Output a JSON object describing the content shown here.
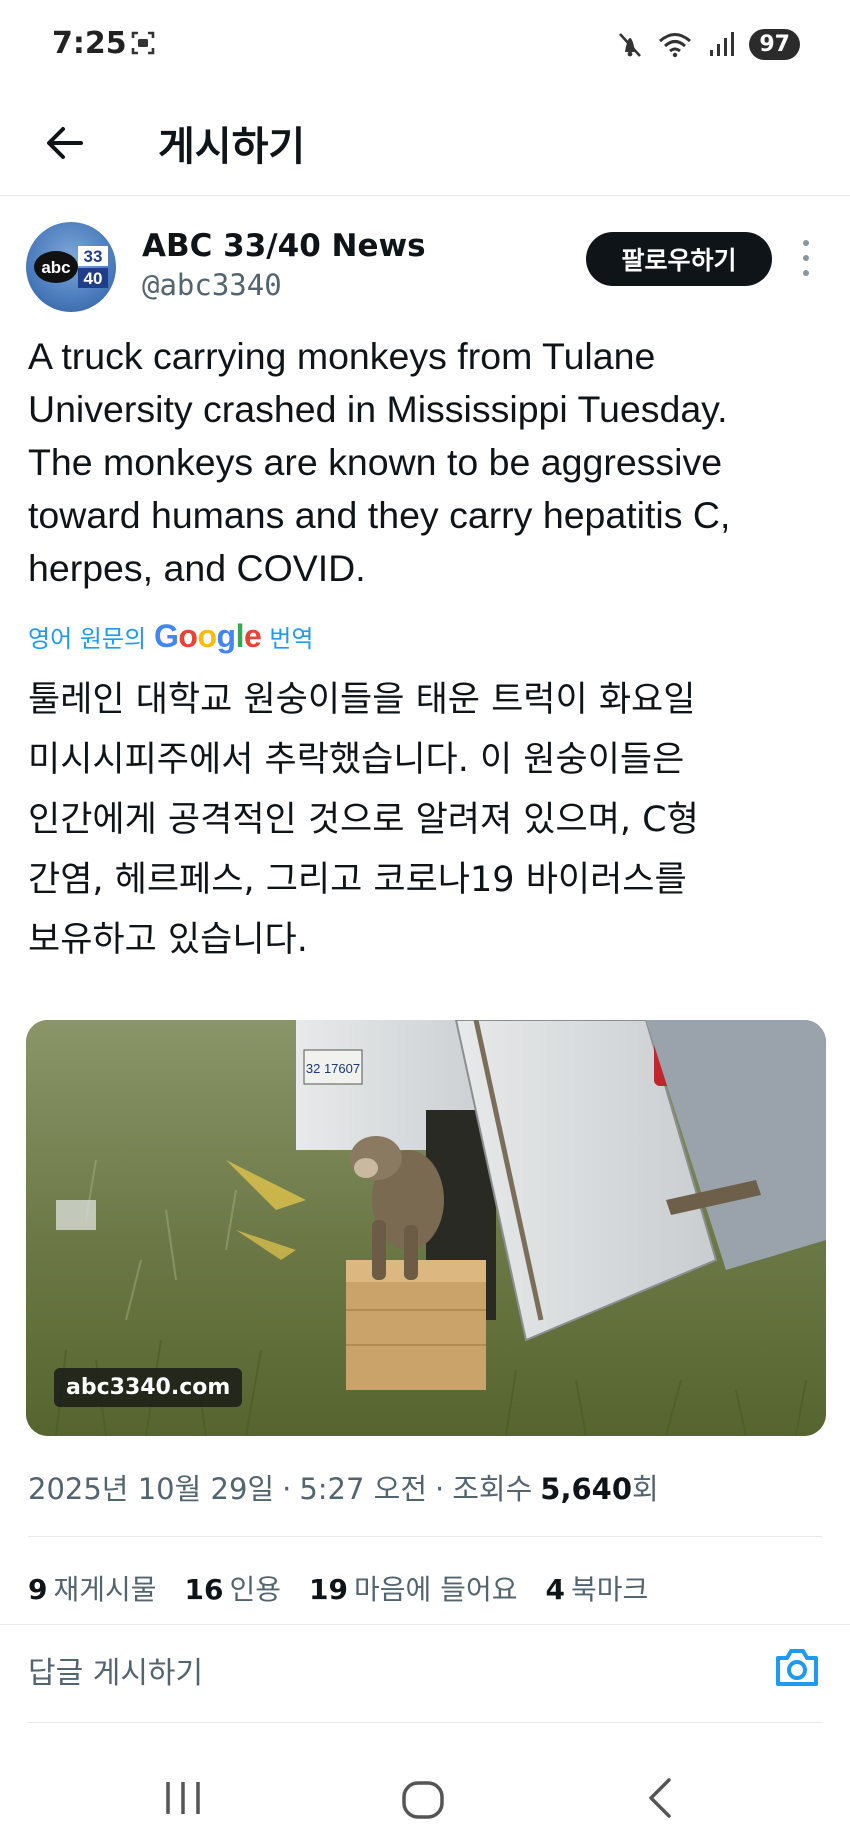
{
  "status_bar": {
    "time": "7:25",
    "battery": "97",
    "icons": [
      "screenshot-icon",
      "mute-icon",
      "wifi-icon",
      "signal-icon"
    ]
  },
  "nav": {
    "title": "게시하기",
    "back_icon": "arrow-left-icon"
  },
  "author": {
    "name": "ABC 33/40 News",
    "handle": "@abc3340",
    "avatar_text": {
      "prefix": "abc",
      "top": "33",
      "bottom": "40"
    },
    "follow_label": "팔로우하기"
  },
  "tweet": {
    "text": "A truck carrying monkeys from Tulane\nUniversity crashed in Mississippi Tuesday.\nThe monkeys are known to be aggressive\ntoward humans and they carry hepatitis C,\nherpes, and COVID.",
    "translate_prefix": "영어 원문의",
    "translate_brand": "Google",
    "translate_suffix": "번역",
    "translated_text": "툴레인 대학교 원숭이들을 태운 트럭이 화요일\n미시시피주에서 추락했습니다. 이 원숭이들은\n인간에게 공격적인 것으로 알려져 있으며, C형\n간염, 헤르페스, 그리고 코로나19 바이러스를\n보유하고 있습니다.",
    "media": {
      "watermark": "abc3340.com",
      "plate_text": "32 17607"
    }
  },
  "meta": {
    "date": "2025년 10월 29일",
    "time": "5:27 오전",
    "views_label": "조회수",
    "views_value": "5,640",
    "views_unit": "회",
    "separator": "·"
  },
  "stats": [
    {
      "count": "9",
      "label": "재게시물"
    },
    {
      "count": "16",
      "label": "인용"
    },
    {
      "count": "19",
      "label": "마음에 들어요"
    },
    {
      "count": "4",
      "label": "북마크"
    }
  ],
  "reply": {
    "placeholder": "답글 게시하기"
  },
  "colors": {
    "accent": "#1d9bf0",
    "text": "#0f1419",
    "secondary": "#536471",
    "follow_bg": "#0f1419"
  }
}
